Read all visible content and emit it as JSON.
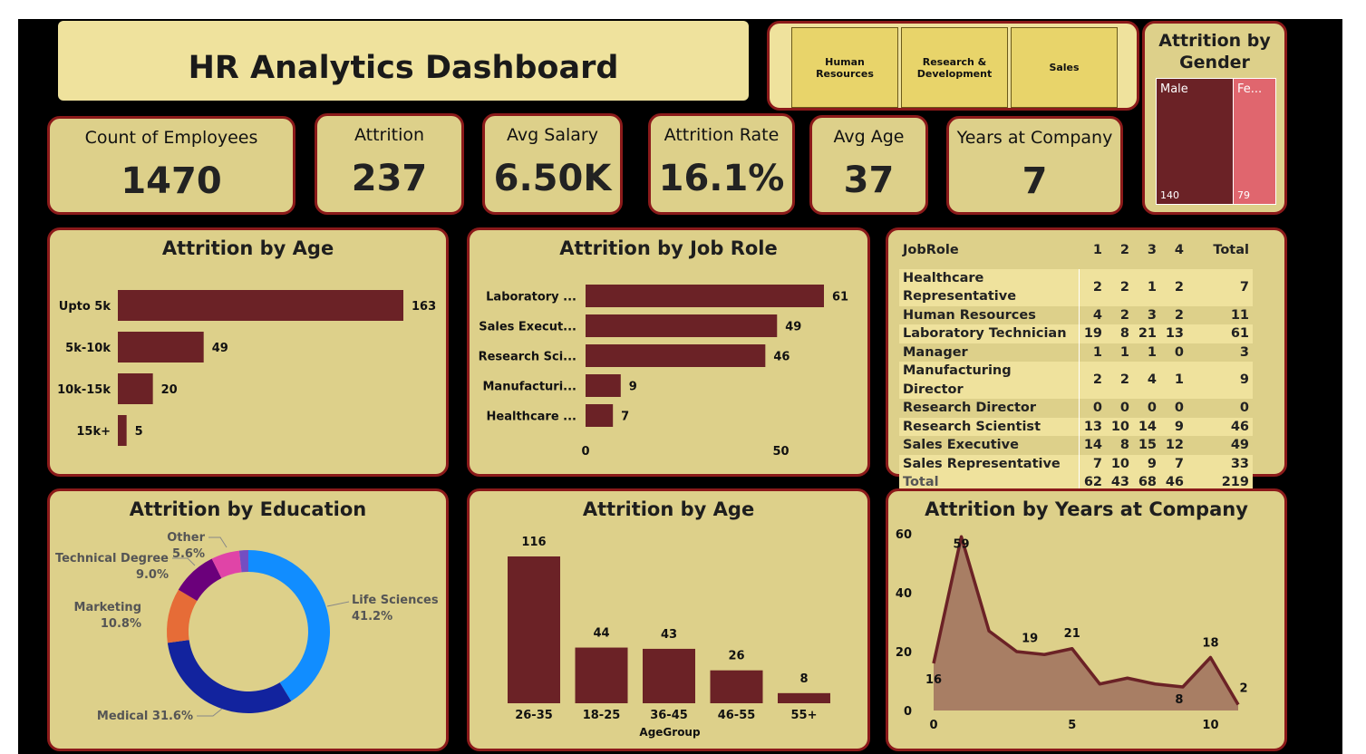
{
  "header": {
    "title": "HR Analytics Dashboard"
  },
  "department_slicer": {
    "options": [
      "Human Resources",
      "Research & Development",
      "Sales"
    ]
  },
  "kpis": [
    {
      "label": "Count of Employees",
      "value": "1470"
    },
    {
      "label": "Attrition",
      "value": "237"
    },
    {
      "label": "Avg Salary",
      "value": "6.50K"
    },
    {
      "label": "Attrition Rate",
      "value": "16.1%"
    },
    {
      "label": "Avg Age",
      "value": "37"
    },
    {
      "label": "Years at Company",
      "value": "7"
    }
  ],
  "gender": {
    "title": "Attrition by Gender",
    "items": [
      {
        "label": "Male",
        "value": 140,
        "value_label": "140",
        "color": "#6b2226"
      },
      {
        "label": "Fe...",
        "value": 79,
        "value_label": "79",
        "color": "#e0666e"
      }
    ]
  },
  "job_role_matrix": {
    "headers": [
      "JobRole",
      "1",
      "2",
      "3",
      "4",
      "Total"
    ],
    "rows": [
      [
        "Healthcare Representative",
        "2",
        "2",
        "1",
        "2",
        "7"
      ],
      [
        "Human Resources",
        "4",
        "2",
        "3",
        "2",
        "11"
      ],
      [
        "Laboratory Technician",
        "19",
        "8",
        "21",
        "13",
        "61"
      ],
      [
        "Manager",
        "1",
        "1",
        "1",
        "0",
        "3"
      ],
      [
        "Manufacturing Director",
        "2",
        "2",
        "4",
        "1",
        "9"
      ],
      [
        "Research Director",
        "0",
        "0",
        "0",
        "0",
        "0"
      ],
      [
        "Research Scientist",
        "13",
        "10",
        "14",
        "9",
        "46"
      ],
      [
        "Sales Executive",
        "14",
        "8",
        "15",
        "12",
        "49"
      ],
      [
        "Sales Representative",
        "7",
        "10",
        "9",
        "7",
        "33"
      ]
    ],
    "total": [
      "Total",
      "62",
      "43",
      "68",
      "46",
      "219"
    ]
  },
  "chart_data": [
    {
      "id": "salary_bar",
      "type": "bar",
      "orientation": "horizontal",
      "title": "Attrition by Age",
      "categories": [
        "Upto 5k",
        "5k-10k",
        "10k-15k",
        "15k+"
      ],
      "values": [
        163,
        49,
        20,
        5
      ],
      "color": "#6b2226"
    },
    {
      "id": "jobrole_bar",
      "type": "bar",
      "orientation": "horizontal",
      "title": "Attrition by Job Role",
      "categories": [
        "Laboratory ...",
        "Sales Execut...",
        "Research Sci...",
        "Manufacturi...",
        "Healthcare ..."
      ],
      "values": [
        61,
        49,
        46,
        9,
        7
      ],
      "xticks": [
        "0",
        "50"
      ],
      "xlim": [
        0,
        61
      ],
      "color": "#6b2226"
    },
    {
      "id": "education_donut",
      "type": "pie",
      "title": "Attrition by Education",
      "slices": [
        {
          "label": "Life Sciences",
          "percent_label": "41.2%",
          "value": 41.2,
          "color": "#118dff"
        },
        {
          "label": "Medical",
          "percent_label": "31.6%",
          "value": 31.6,
          "color": "#12239e"
        },
        {
          "label": "Marketing",
          "percent_label": "10.8%",
          "value": 10.8,
          "color": "#e66c37"
        },
        {
          "label": "Technical Degree",
          "percent_label": "9.0%",
          "value": 9.0,
          "color": "#6b007b"
        },
        {
          "label": "Other",
          "percent_label": "5.6%",
          "value": 5.6,
          "color": "#e044a7"
        },
        {
          "label": "",
          "percent_label": "",
          "value": 1.8,
          "color": "#744ec2"
        }
      ]
    },
    {
      "id": "agegroup_bar",
      "type": "bar",
      "title": "Attrition by Age",
      "xlabel": "AgeGroup",
      "categories": [
        "26-35",
        "18-25",
        "36-45",
        "46-55",
        "55+"
      ],
      "values": [
        116,
        44,
        43,
        26,
        8
      ],
      "color": "#6b2226"
    },
    {
      "id": "years_area",
      "type": "area",
      "title": "Attrition by Years at Company",
      "x": [
        0,
        1,
        2,
        3,
        4,
        5,
        6,
        7,
        8,
        9,
        10,
        11
      ],
      "y": [
        16,
        59,
        27,
        20,
        19,
        21,
        9,
        11,
        9,
        8,
        18,
        2
      ],
      "labeled_points": [
        0,
        1,
        4,
        5,
        9,
        10,
        11
      ],
      "xticks": [
        0,
        5,
        10
      ],
      "yticks": [
        0,
        20,
        40,
        60
      ],
      "ylim": [
        0,
        60
      ],
      "line_color": "#6b2226",
      "fill_color": "#a87e64"
    }
  ]
}
